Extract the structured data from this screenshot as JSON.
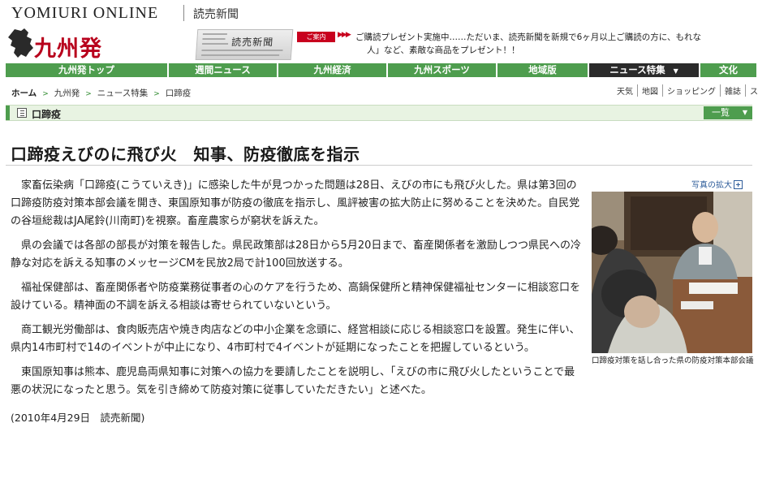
{
  "masthead": {
    "brand": "YOMIURI ONLINE",
    "brand_sub": "読売新聞"
  },
  "logo": {
    "text": "九州発",
    "shape_icon": "kyushu-map-icon"
  },
  "promo": {
    "image_title": "読売新聞",
    "tag": "ご案内",
    "line1": "ご購読プレゼント実施中……ただいま、読売新聞を新規で6ヶ月以上ご購読の方に、もれな",
    "line2": "人」など、素敵な商品をプレゼント！！"
  },
  "nav": {
    "items": [
      {
        "label": "九州発トップ",
        "w": 201
      },
      {
        "label": "週間ニュース",
        "w": 135
      },
      {
        "label": "九州経済",
        "w": 135
      },
      {
        "label": "九州スポーツ",
        "w": 135
      },
      {
        "label": "地域版",
        "w": 113
      },
      {
        "label": "ニュース特集",
        "w": 137,
        "active": true,
        "caret": "▼"
      },
      {
        "label": "文化",
        "w": 71
      }
    ]
  },
  "breadcrumb": {
    "items": [
      "ホーム",
      "九州発",
      "ニュース特集",
      "口蹄疫"
    ],
    "separator": ">"
  },
  "utility_links": [
    "天気",
    "地図",
    "ショッピング",
    "雑誌",
    "ス"
  ],
  "section": {
    "label": "口蹄疫",
    "list_button": "一覧",
    "list_caret": "▼"
  },
  "article": {
    "headline": "口蹄疫えびのに飛び火　知事、防疫徹底を指示",
    "paragraphs": [
      "家畜伝染病「口蹄疫(こうていえき)」に感染した牛が見つかった問題は28日、えびの市にも飛び火した。県は第3回の口蹄疫防疫対策本部会議を開き、東国原知事が防疫の徹底を指示し、風評被害の拡大防止に努めることを決めた。自民党の谷垣総裁はJA尾鈴(川南町)を視察。畜産農家らが窮状を訴えた。",
      "県の会議では各部の部長が対策を報告した。県民政策部は28日から5月20日まで、畜産関係者を激励しつつ県民への冷静な対応を訴える知事のメッセージCMを民放2局で計100回放送する。",
      "福祉保健部は、畜産関係者や防疫業務従事者の心のケアを行うため、高鍋保健所と精神保健福祉センターに相談窓口を設けている。精神面の不調を訴える相談は寄せられていないという。",
      "商工観光労働部は、食肉販売店や焼き肉店などの中小企業を念頭に、経営相談に応じる相談窓口を設置。発生に伴い、県内14市町村で14のイベントが中止になり、4市町村で4イベントが延期になったことを把握しているという。",
      "東国原知事は熊本、鹿児島両県知事に対策への協力を要請したことを説明し、「えびの市に飛び火したということで最悪の状況になったと思う。気を引き締めて防疫対策に従事していただきたい」と述べた。"
    ],
    "date": "(2010年4月29日　読売新聞)"
  },
  "photo": {
    "enlarge_label": "写真の拡大",
    "caption": "口蹄疫対策を話し合った県の防疫対策本部会議"
  },
  "colors": {
    "nav_green": "#4e9d4e",
    "nav_active": "#2b2b2b",
    "logo_red": "#b8001c",
    "notice_red": "#c8001e"
  }
}
